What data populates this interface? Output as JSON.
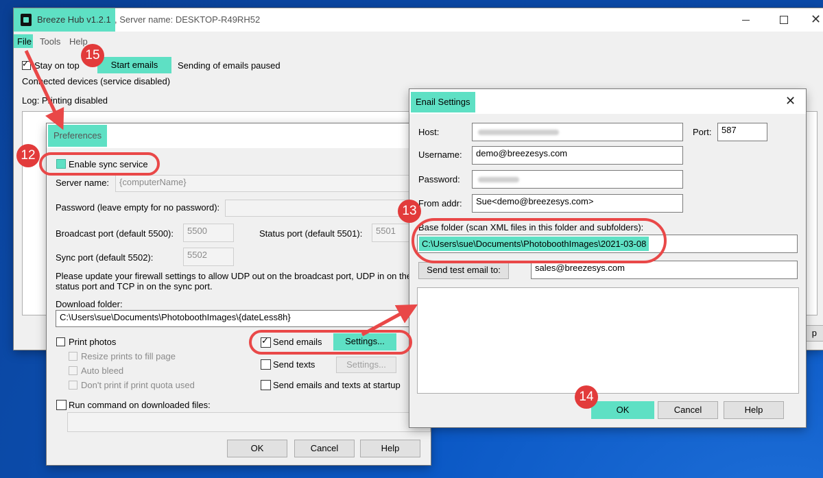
{
  "main_window": {
    "app_title": "Breeze Hub v1.2.1",
    "server_name": ", Server name: DESKTOP-R49RH52",
    "menu": [
      "File",
      "Tools",
      "Help"
    ],
    "stay_on_top": "Stay on top",
    "start_emails": "Start emails",
    "sending_status": "Sending of emails paused",
    "connected_devices": "Connected devices (service disabled)",
    "log_status": "Log: Printing disabled",
    "partial_button": "p"
  },
  "preferences": {
    "title": "Preferences",
    "enable_sync": "Enable sync service",
    "server_name_label": "Server name:",
    "server_name_placeholder": "{computerName}",
    "password_label": "Password (leave empty for no password):",
    "broadcast_label": "Broadcast port (default 5500):",
    "broadcast_value": "5500",
    "status_label": "Status port (default 5501):",
    "status_value": "5501",
    "sync_label": "Sync port (default 5502):",
    "sync_value": "5502",
    "firewall_note_1": "Please update your firewall settings to allow UDP out on the broadcast port, UDP in on the",
    "firewall_note_2": "status port and TCP in on the sync port.",
    "download_label": "Download folder:",
    "download_value": "C:\\Users\\sue\\Documents\\PhotoboothImages\\{dateLess8h}",
    "print_photos": "Print photos",
    "resize_prints": "Resize prints to fill page",
    "auto_bleed": "Auto bleed",
    "dont_print": "Don't print if print quota used",
    "send_emails": "Send emails",
    "settings_btn": "Settings...",
    "send_texts": "Send texts",
    "settings_btn2": "Settings...",
    "send_startup": "Send emails and texts at startup",
    "run_command": "Run command on downloaded files:",
    "ok": "OK",
    "cancel": "Cancel",
    "help": "Help"
  },
  "email_settings": {
    "title": "Enail Settings",
    "host_label": "Host:",
    "port_label": "Port:",
    "port_value": "587",
    "username_label": "Username:",
    "username_value": "demo@breezesys.com",
    "password_label": "Password:",
    "from_label": "From addr:",
    "from_value": "Sue<demo@breezesys.com>",
    "base_folder_label": "Base folder (scan XML files in this folder and subfolders):",
    "base_folder_value": "C:\\Users\\sue\\Documents\\PhotoboothImages\\2021-03-08",
    "send_test_btn": "Send test email to:",
    "test_email_value": "sales@breezesys.com",
    "ok": "OK",
    "cancel": "Cancel",
    "help": "Help"
  },
  "badges": [
    "12",
    "13",
    "14",
    "15"
  ],
  "colors": {
    "highlight": "#5ee0c4",
    "annotation_red": "#e94848",
    "badge_red": "#e23b3b",
    "desktop_blue": "#0a57c4"
  },
  "icons": [
    "app-icon",
    "minimize-icon",
    "maximize-icon",
    "close-icon",
    "checkbox-checked-icon"
  ]
}
